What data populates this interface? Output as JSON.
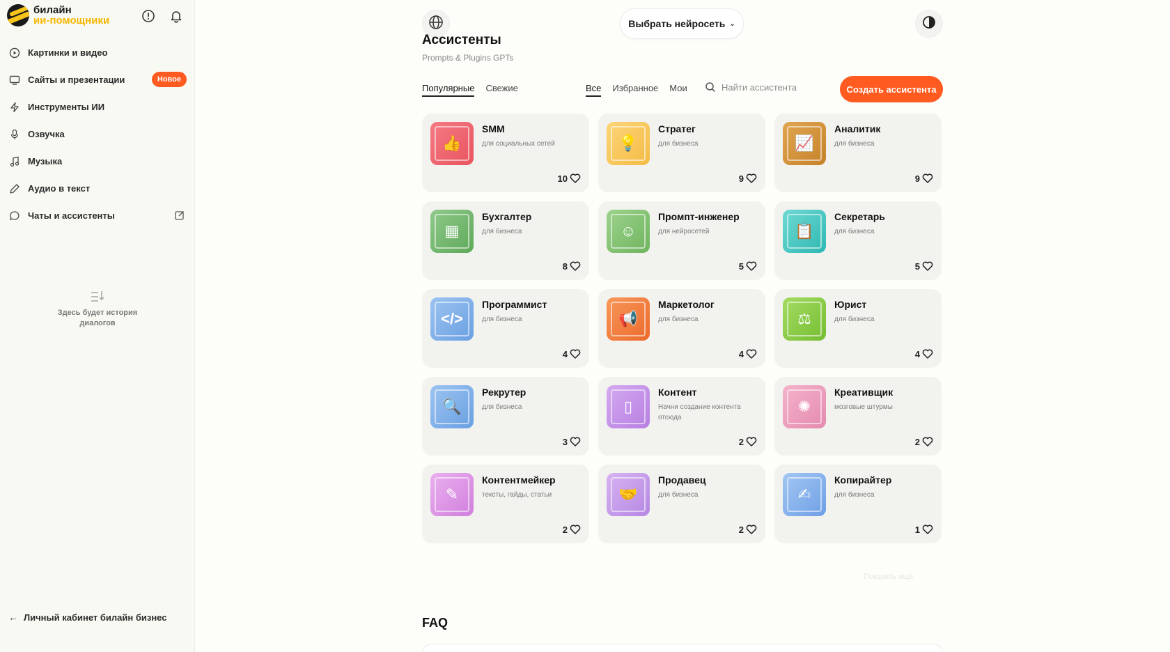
{
  "brand": {
    "top": "билайн",
    "bottom": "ии-помощники"
  },
  "sidebar": {
    "items": [
      {
        "label": "Картинки и видео",
        "icon": "play-circle-icon"
      },
      {
        "label": "Сайты и презентации",
        "icon": "monitor-icon",
        "badge": "Новое"
      },
      {
        "label": "Инструменты ИИ",
        "icon": "lightning-icon"
      },
      {
        "label": "Озвучка",
        "icon": "microphone-icon"
      },
      {
        "label": "Музыка",
        "icon": "music-note-icon"
      },
      {
        "label": "Аудио в текст",
        "icon": "pen-icon"
      },
      {
        "label": "Чаты и ассистенты",
        "icon": "chat-icon"
      }
    ],
    "empty_history": "Здесь будет история диалогов",
    "footer_link": "Личный кабинет билайн бизнес"
  },
  "header": {
    "model_select": "Выбрать нейросеть",
    "title": "Ассистенты",
    "subtitle": "Prompts & Plugins GPTs"
  },
  "tabs": [
    "Популярные",
    "Свежие"
  ],
  "filters": [
    "Все",
    "Избранное",
    "Мои"
  ],
  "search": {
    "placeholder": "Найти ассистента"
  },
  "create_button": "Создать ассистента",
  "cards": [
    {
      "title": "SMM",
      "subtitle": "для социальных сетей",
      "likes": "10",
      "color1": "#f47a83",
      "color2": "#e9545f",
      "glyph": "👍"
    },
    {
      "title": "Стратег",
      "subtitle": "для бизнеса",
      "likes": "9",
      "color1": "#fbd57a",
      "color2": "#f5bb43",
      "glyph": "💡"
    },
    {
      "title": "Аналитик",
      "subtitle": "для бизнеса",
      "likes": "9",
      "color1": "#e0a650",
      "color2": "#c6822a",
      "glyph": "📈"
    },
    {
      "title": "Бухгалтер",
      "subtitle": "для бизнеса",
      "likes": "8",
      "color1": "#8fc98a",
      "color2": "#5fa95a",
      "glyph": "▦"
    },
    {
      "title": "Промпт-инженер",
      "subtitle": "для нейросетей",
      "likes": "5",
      "color1": "#9dd38c",
      "color2": "#6fb45f",
      "glyph": "☺"
    },
    {
      "title": "Секретарь",
      "subtitle": "для бизнеса",
      "likes": "5",
      "color1": "#6fd9d3",
      "color2": "#2fb8b2",
      "glyph": "📋"
    },
    {
      "title": "Программист",
      "subtitle": "для бизнеса",
      "likes": "4",
      "color1": "#9cc4f1",
      "color2": "#6a9fe2",
      "glyph": "</>"
    },
    {
      "title": "Маркетолог",
      "subtitle": "для бизнеса",
      "likes": "4",
      "color1": "#f7975a",
      "color2": "#ec6a2b",
      "glyph": "📢"
    },
    {
      "title": "Юрист",
      "subtitle": "для бизнеса",
      "likes": "4",
      "color1": "#a5dc63",
      "color2": "#74bd31",
      "glyph": "⚖"
    },
    {
      "title": "Рекрутер",
      "subtitle": "для бизнеса",
      "likes": "3",
      "color1": "#9cc4f1",
      "color2": "#6a9fe2",
      "glyph": "🔍"
    },
    {
      "title": "Контент",
      "subtitle": "Начни создание контента отсюда",
      "likes": "2",
      "color1": "#d4aaf0",
      "color2": "#b77fe2",
      "glyph": "▯"
    },
    {
      "title": "Креативщик",
      "subtitle": "мозговые штурмы",
      "likes": "2",
      "color1": "#f4b3cb",
      "color2": "#e58aaf",
      "glyph": "✺"
    },
    {
      "title": "Контентмейкер",
      "subtitle": "тексты, гайды, статьи",
      "likes": "2",
      "color1": "#eab0ef",
      "color2": "#d07fdc",
      "glyph": "✎"
    },
    {
      "title": "Продавец",
      "subtitle": "для бизнеса",
      "likes": "2",
      "color1": "#d7b3f2",
      "color2": "#b587e3",
      "glyph": "🤝"
    },
    {
      "title": "Копирайтер",
      "subtitle": "для бизнеса",
      "likes": "1",
      "color1": "#a3c7f3",
      "color2": "#6e9fe5",
      "glyph": "✍"
    }
  ],
  "show_more": "Показать ещё",
  "faq_title": "FAQ"
}
